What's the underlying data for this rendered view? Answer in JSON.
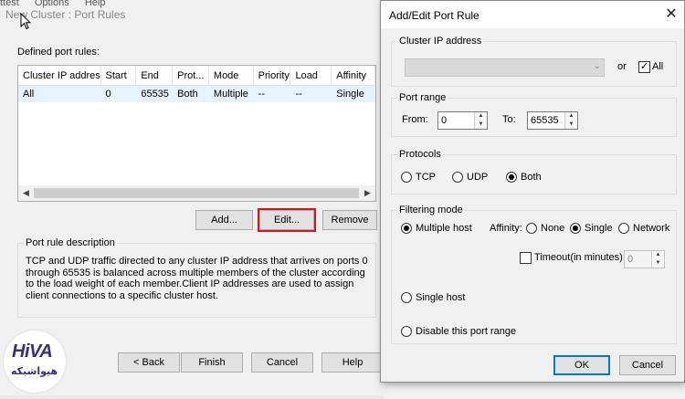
{
  "background_window": {
    "menu": [
      "ttest",
      "Options",
      "Help"
    ],
    "title": "New Cluster : Port Rules",
    "defined_label": "Defined port rules:",
    "columns": [
      "Cluster IP address",
      "Start",
      "End",
      "Prot...",
      "Mode",
      "Priority",
      "Load",
      "Affinity"
    ],
    "rows": [
      [
        "All",
        "0",
        "65535",
        "Both",
        "Multiple",
        "--",
        "--",
        "Single"
      ]
    ],
    "buttons": {
      "add": "Add...",
      "edit": "Edit...",
      "remove": "Remove"
    },
    "description_title": "Port rule description",
    "description_text": "TCP and UDP traffic directed to any cluster IP address that arrives on ports 0 through 65535 is balanced across multiple members of the cluster according to the load weight of each member.Client IP addresses are used to assign client connections to a specific cluster host.",
    "wizard_buttons": {
      "back": "< Back",
      "finish": "Finish",
      "cancel": "Cancel",
      "help": "Help"
    }
  },
  "logo": {
    "main": "HiVA",
    "sub": "هیواشبکه",
    "color": "#3e2d7a"
  },
  "dialog": {
    "title": "Add/Edit Port Rule",
    "close_glyph": "✕",
    "cluster_ip": {
      "group_title": "Cluster IP address",
      "address_value": "",
      "or_label": "or",
      "all_label": "All",
      "all_checked": true
    },
    "port_range": {
      "group_title": "Port range",
      "from_label": "From:",
      "from_value": "0",
      "to_label": "To:",
      "to_value": "65535"
    },
    "protocols": {
      "group_title": "Protocols",
      "options": [
        "TCP",
        "UDP",
        "Both"
      ],
      "selected": "Both"
    },
    "filtering": {
      "group_title": "Filtering mode",
      "multiple_host_label": "Multiple host",
      "affinity_label": "Affinity:",
      "affinity_options": [
        "None",
        "Single",
        "Network"
      ],
      "affinity_selected": "Single",
      "timeout_label": "Timeout(in minutes):",
      "timeout_value": "0",
      "single_host_label": "Single host",
      "disable_label": "Disable this port range",
      "selected": "Multiple host"
    },
    "ok_label": "OK",
    "cancel_label": "Cancel"
  },
  "colors": {
    "highlight_border": "#d21818",
    "selected_row": "#e5f3ff",
    "default_button_border": "#0078d7"
  }
}
